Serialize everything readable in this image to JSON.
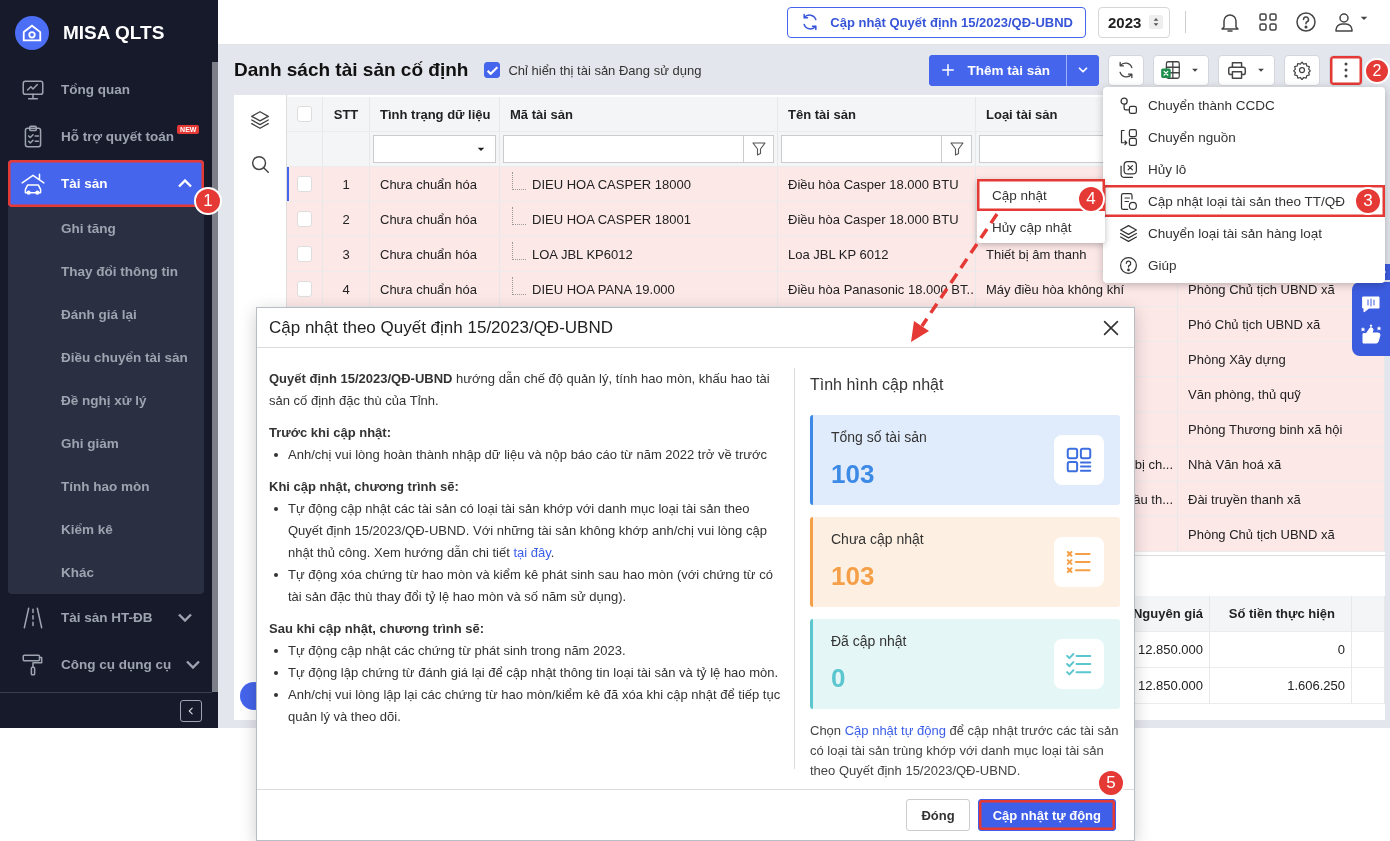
{
  "app": {
    "name": "MISA QLTS"
  },
  "sidebar": {
    "items": [
      {
        "label": "Tổng quan",
        "selected": false
      },
      {
        "label": "Hỗ trợ quyết toán",
        "badge": "NEW",
        "selected": false
      },
      {
        "label": "Tài sản",
        "selected": true,
        "expanded": true,
        "annotation": "1",
        "children": [
          {
            "label": "Ghi tăng"
          },
          {
            "label": "Thay đổi thông tin"
          },
          {
            "label": "Đánh giá lại"
          },
          {
            "label": "Điều chuyển tài sản"
          },
          {
            "label": "Đề nghị xử lý"
          },
          {
            "label": "Ghi giảm"
          },
          {
            "label": "Tính hao mòn"
          },
          {
            "label": "Kiểm kê"
          },
          {
            "label": "Khác"
          }
        ]
      },
      {
        "label": "Tài sản HT-ĐB",
        "selected": false,
        "expanded": false
      },
      {
        "label": "Công cụ dụng cụ",
        "selected": false,
        "expanded": false
      }
    ]
  },
  "topbar": {
    "update_button": "Cập nhật Quyết định 15/2023/QĐ-UBND",
    "year": "2023"
  },
  "page": {
    "title": "Danh sách tài sản cố định",
    "filter_checkbox": {
      "label": "Chỉ hiển thị tài sản Đang sử dụng",
      "checked": true
    },
    "add_button": "Thêm tài sản",
    "more_button": {
      "annotation": "2"
    }
  },
  "menu": {
    "items": [
      {
        "label": "Chuyển thành CCDC"
      },
      {
        "label": "Chuyển nguồn"
      },
      {
        "label": "Hủy lô"
      },
      {
        "label": "Cập nhật loại tài sản theo TT/QĐ",
        "has_submenu": true,
        "annotation": "3"
      },
      {
        "label": "Chuyển loại tài sản hàng loạt"
      },
      {
        "label": "Giúp"
      }
    ]
  },
  "submenu": {
    "items": [
      {
        "label": "Cập nhật",
        "annotation": "4"
      },
      {
        "label": "Hủy cập nhật"
      }
    ]
  },
  "table": {
    "all_checked": false,
    "columns": [
      "STT",
      "Tình trạng dữ liệu",
      "Mã tài sản",
      "Tên tài sản",
      "Loại tài sản"
    ],
    "rows": [
      {
        "checked": false,
        "focused": true,
        "stt": "1",
        "status": "Chưa chuẩn hóa",
        "code": "DIEU HOA CASPER 18000",
        "name": "Điều hòa Casper 18.000 BTU"
      },
      {
        "checked": false,
        "focused": false,
        "stt": "2",
        "status": "Chưa chuẩn hóa",
        "code": "DIEU HOA CASPER 18001",
        "name": "Điều hòa Casper 18.000 BTU"
      },
      {
        "checked": false,
        "focused": false,
        "stt": "3",
        "status": "Chưa chuẩn hóa",
        "code": "LOA JBL KP6012",
        "name": "Loa JBL KP 6012",
        "type": "Thiết bị âm thanh"
      },
      {
        "checked": false,
        "focused": false,
        "stt": "4",
        "status": "Chưa chuẩn hóa",
        "code": "DIEU HOA PANA 19.000",
        "name": "Điều hòa Panasonic 18.000 BT...",
        "type": "Máy điều hòa không khí",
        "dept": "Phòng Chủ tịch UBND xã"
      },
      {
        "dept": "Phó Chủ tịch UBND xã"
      },
      {
        "dept": "Phòng Xây dựng"
      },
      {
        "dept": "Văn phòng, thủ quỹ"
      },
      {
        "dept": "Phòng Thương binh xã hội"
      },
      {
        "type": "bị ch...",
        "dept": "Nhà Văn hoá xã"
      },
      {
        "type": "ầu th...",
        "dept": "Đài truyền thanh xã"
      },
      {
        "dept": "Phòng Chủ tịch UBND xã"
      }
    ]
  },
  "detail_table": {
    "columns": [
      "Nguyên giá",
      "Số tiền thực hiện"
    ],
    "rows": [
      [
        "12.850.000",
        "0"
      ],
      [
        "12.850.000",
        "1.606.250"
      ]
    ]
  },
  "modal": {
    "title": "Cập nhật theo Quyết định 15/2023/QĐ-UBND",
    "intro": "**Quyết định 15/2023/QĐ-UBND** hướng dẫn chế độ quản lý, tính hao mòn, khấu hao tài sản cố định đặc thù của Tỉnh.",
    "sections": [
      {
        "heading": "Trước khi cập nhật:",
        "bullets": [
          {
            "text": "Anh/chị vui lòng hoàn thành nhập dữ liệu và nộp báo cáo từ năm 2022 trở về trước"
          }
        ]
      },
      {
        "heading": "Khi cập nhật, chương trình sẽ:",
        "bullets": [
          {
            "text": "Tự động cập nhật các tài sản có loại tài sản khớp với danh mục loại tài sản theo Quyết định 15/2023/QĐ-UBND. Với những tài sản không khớp anh/chị vui lòng cập nhật thủ công. Xem hướng dẫn chi tiết ",
            "link": "tại đây",
            "after": "."
          },
          {
            "text": "Tự động xóa chứng từ hao mòn và kiểm kê phát sinh sau hao mòn (với chứng từ có tài sản đặc thù thay đổi tỷ lệ hao mòn và số năm sử dụng)."
          }
        ]
      },
      {
        "heading": "Sau khi cập nhật, chương trình sẽ:",
        "bullets": [
          {
            "text": "Tự động cập nhật các chứng từ phát sinh trong năm 2023."
          },
          {
            "text": "Tự động lập chứng từ đánh giá lại để cập nhật thông tin loại tài sản và tỷ lệ hao mòn."
          },
          {
            "text": "Anh/chị vui lòng lập lại các chứng từ hao mòn/kiểm kê đã xóa khi cập nhật để tiếp tục quản lý và theo dõi."
          }
        ]
      }
    ],
    "status_title": "Tình hình cập nhật",
    "cards": [
      {
        "label": "Tổng số tài sản",
        "value": "103",
        "kind": "total",
        "color": "#3d8ae6"
      },
      {
        "label": "Chưa cập nhật",
        "value": "103",
        "kind": "pending",
        "color": "#f5a049"
      },
      {
        "label": "Đã cập nhật",
        "value": "0",
        "kind": "done",
        "color": "#5cc6cf"
      }
    ],
    "note": {
      "before": "Chọn ",
      "link": "Cập nhật tự động",
      "after": " để cập nhật trước các tài sản có loại tài sản trùng khớp với danh mục loại tài sản theo Quyết định 15/2023/QĐ-UBND."
    },
    "buttons": [
      {
        "label": "Đóng",
        "kind": "secondary"
      },
      {
        "label": "Cập nhật tự động",
        "kind": "primary",
        "annotation": "5"
      }
    ]
  }
}
